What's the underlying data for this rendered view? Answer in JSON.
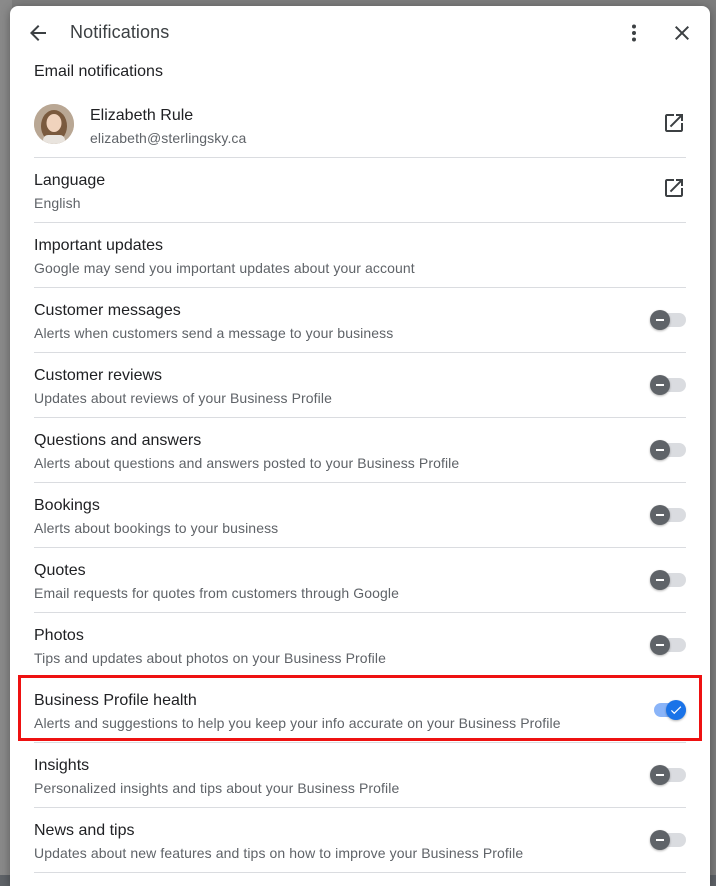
{
  "header": {
    "title": "Notifications",
    "back_icon": "arrow-back-icon",
    "more_icon": "more-vert-icon",
    "close_icon": "close-icon"
  },
  "section_title": "Email notifications",
  "account": {
    "name": "Elizabeth Rule",
    "email": "elizabeth@sterlingsky.ca",
    "action_icon": "open-in-new-icon"
  },
  "language": {
    "title": "Language",
    "value": "English",
    "action_icon": "open-in-new-icon"
  },
  "important": {
    "title": "Important updates",
    "subtitle": "Google may send you important updates about your account"
  },
  "settings": [
    {
      "title": "Customer messages",
      "subtitle": "Alerts when customers send a message to your business",
      "enabled": false
    },
    {
      "title": "Customer reviews",
      "subtitle": "Updates about reviews of your Business Profile",
      "enabled": false
    },
    {
      "title": "Questions and answers",
      "subtitle": "Alerts about questions and answers posted to your Business Profile",
      "enabled": false
    },
    {
      "title": "Bookings",
      "subtitle": "Alerts about bookings to your business",
      "enabled": false
    },
    {
      "title": "Quotes",
      "subtitle": "Email requests for quotes from customers through Google",
      "enabled": false
    },
    {
      "title": "Photos",
      "subtitle": "Tips and updates about photos on your Business Profile",
      "enabled": false
    },
    {
      "title": "Business Profile health",
      "subtitle": "Alerts and suggestions to help you keep your info accurate on your Business Profile",
      "enabled": true
    },
    {
      "title": "Insights",
      "subtitle": "Personalized insights and tips about your Business Profile",
      "enabled": false
    },
    {
      "title": "News and tips",
      "subtitle": "Updates about new features and tips on how to improve your Business Profile",
      "enabled": false
    }
  ],
  "colors": {
    "accent": "#1a73e8",
    "highlight": "#ee1111"
  }
}
